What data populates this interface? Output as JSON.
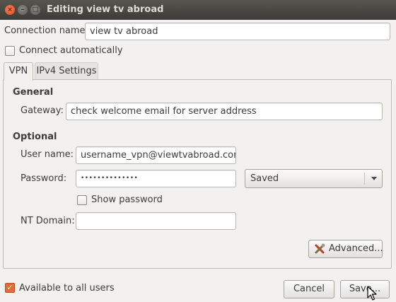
{
  "window": {
    "title": "Editing view tv abroad",
    "close": "×",
    "minimize": "–",
    "maximize": "□"
  },
  "connection_name": {
    "label": "Connection name:",
    "value": "view tv abroad"
  },
  "connect_automatically": {
    "label": "Connect automatically",
    "checked": false
  },
  "tabs": [
    {
      "label": "VPN",
      "active": true
    },
    {
      "label": "IPv4 Settings",
      "active": false
    }
  ],
  "general": {
    "heading": "General",
    "gateway_label": "Gateway:",
    "gateway_value": "check welcome email for server address"
  },
  "optional": {
    "heading": "Optional",
    "username_label": "User name:",
    "username_value": "username_vpn@viewtvabroad.com",
    "password_label": "Password:",
    "password_value": "••••••••••••••",
    "password_storage": "Saved",
    "show_password_label": "Show password",
    "show_password_checked": false,
    "nt_domain_label": "NT Domain:",
    "nt_domain_value": ""
  },
  "advanced_button": "Advanced...",
  "available_all_users": {
    "label": "Available to all users",
    "checked": true,
    "check_mark": "✓"
  },
  "buttons": {
    "cancel": "Cancel",
    "save": "Save..."
  },
  "colors": {
    "accent": "#e26b38",
    "titlebar": "#3c3b37",
    "window_bg": "#f2f1f0"
  }
}
